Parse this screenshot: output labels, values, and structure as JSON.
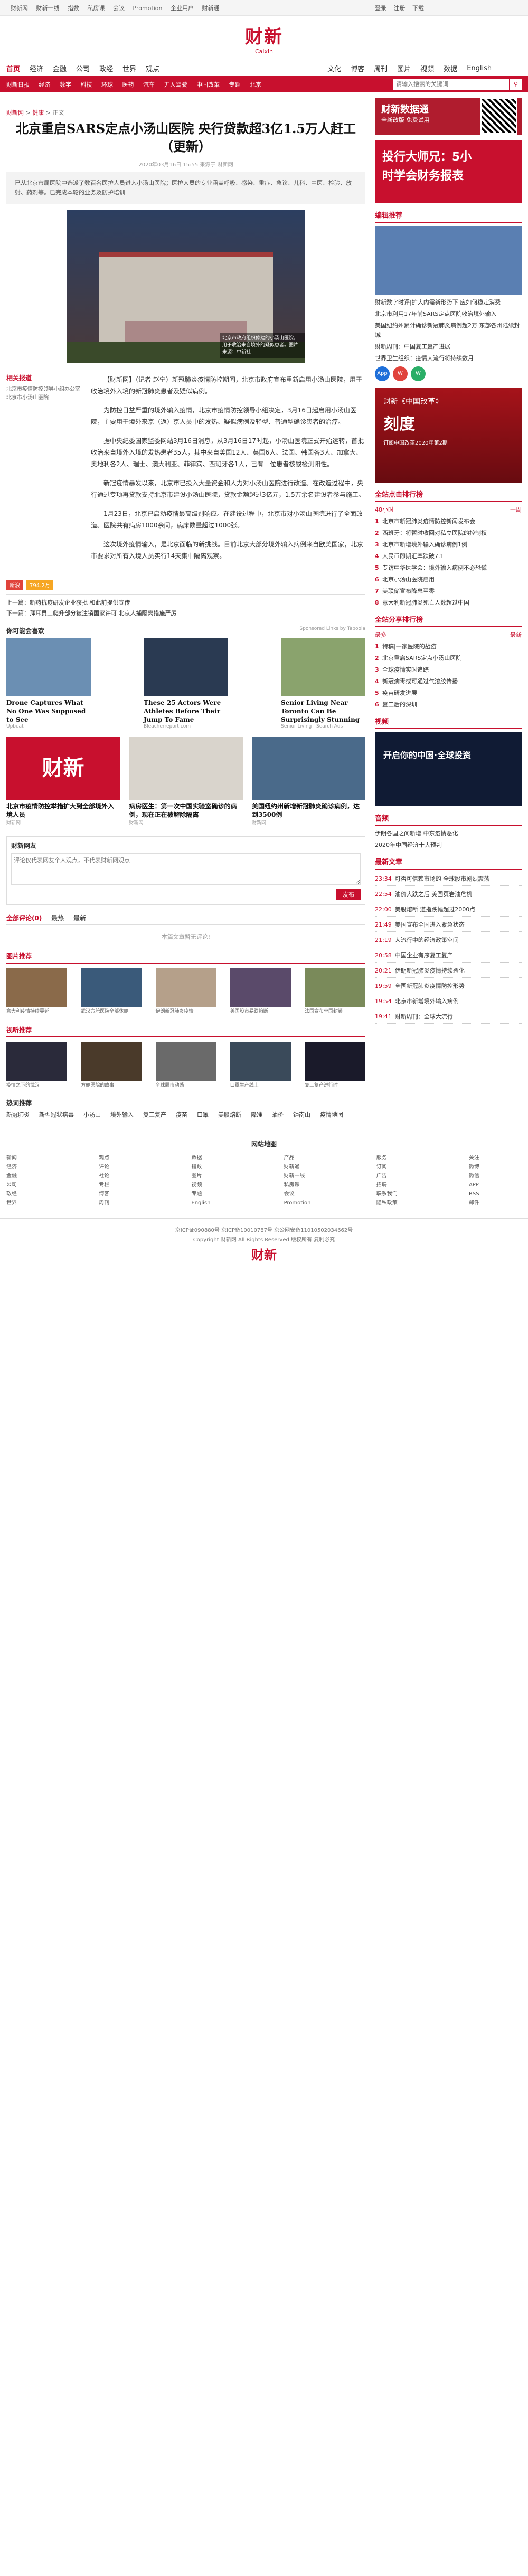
{
  "topbar": {
    "nav": [
      "财新网",
      "财新一线",
      "指数",
      "私房课",
      "会议",
      "Promotion",
      "企业用户",
      "财新通"
    ],
    "right": [
      "登录",
      "注册"
    ],
    "extra": "下载"
  },
  "logo": {
    "cn": "财新",
    "en": "Caixin"
  },
  "mainnav": {
    "items": [
      "首页",
      "经济",
      "金融",
      "公司",
      "政经",
      "世界",
      "观点",
      "文化",
      "博客",
      "周刊",
      "图片",
      "视频",
      "数据",
      "English"
    ]
  },
  "subnav": {
    "items": [
      "财新日报",
      "经济",
      "数字",
      "科技",
      "环球",
      "医药",
      "汽车",
      "无人驾驶",
      "中国改革",
      "专题",
      "北京"
    ],
    "search_placeholder": "请输入搜索的关键词"
  },
  "breadcrumb": {
    "a": "财新网",
    "b": "健康",
    "c": "正文"
  },
  "article": {
    "title": "北京重启SARS定点小汤山医院 央行贷款超3亿1.5万人赶工（更新）",
    "meta": "2020年03月16日 15:55  来源于 财新网",
    "summary": "已从北京市属医院中选派了数百名医护人员进入小汤山医院；医护人员的专业涵盖呼吸、感染、重症、急诊、儿科、中医、检验、放射、药剂等。已完成本轮的业务及防护培训",
    "photo_caption": "北京市政府组织修建的小汤山医院，用于收治来自境外的疑似患者。图片来源：中新社",
    "photo_side": "北京市疫情防控领导小组办公室 北京市小汤山医院",
    "p1": "【财新网】（记者 赵宁）新冠肺炎疫情防控期间，北京市政府宣布重新启用小汤山医院，用于收治境外入境的新冠肺炎患者及疑似病例。",
    "p2": "为防控日益严重的境外输入疫情，北京市疫情防控领导小组决定，3月16日起启用小汤山医院，主要用于境外来京（返）京人员中的发热、疑似病例及轻型、普通型确诊患者的治疗。",
    "p3": "据中央纪委国家监委网站3月16日消息，从3月16日17时起，小汤山医院正式开始运转，首批收治来自境外入境的发热患者35人，其中来自美国12人、英国6人、法国、韩国各3人、加拿大、奥地利各2人、瑞士、澳大利亚、菲律宾、西班牙各1人，已有一位患者核酸检测阳性。",
    "p4": "新冠疫情暴发以来，北京市已投入大量资金和人力对小汤山医院进行改造。在改造过程中，央行通过专项再贷款支持北京市建设小汤山医院，贷款金额超过3亿元，1.5万余名建设者参与施工。",
    "p5": "1月23日，北京已启动疫情最高级别响应。在建设过程中，北京市对小汤山医院进行了全面改造。医院共有病房1000余间，病床数量超过1000张。",
    "p6": "这次境外疫情输入，是北京面临的新挑战。目前北京大部分境外输入病例来自欧美国家，北京市要求对所有入境人员实行14天集中隔离观察。"
  },
  "share": {
    "weibo": "新浪",
    "count": "794.2万"
  },
  "prevnext": {
    "prev": "上一篇：新药抗疫研发企业获批 和此前提供宣传",
    "next": "下一篇：拜耳员工爬升部分被注销国家许可 北京人捕隔离措施严厉"
  },
  "maylike": {
    "title": "你可能会喜欢",
    "tab": "Sponsored Links by Taboola",
    "cards": [
      {
        "t": "Drone Captures What No One Was Supposed to See",
        "s": "Upbeat"
      },
      {
        "t": "These 25 Actors Were Athletes Before Their Jump To Fame",
        "s": "Bleacherreport.com"
      },
      {
        "t": "Senior Living Near Toronto Can Be Surprisingly Stunning",
        "s": "Senior Living | Search Ads"
      }
    ],
    "cards2": [
      {
        "t": "北京市疫情防控举措扩大到全部境外入境人员",
        "s": "财新网"
      },
      {
        "t": "病房医生：第一次中国实验室确诊的病例，现在正在被解除隔离",
        "s": "财新网"
      },
      {
        "t": "美国纽约州新增新冠肺炎确诊病例，达到3500例",
        "s": "财新网"
      }
    ]
  },
  "comment": {
    "title": "财新网友",
    "placeholder": "评论仅代表网友个人观点，不代表财新网观点",
    "button": "发布"
  },
  "tabs": {
    "a": "全部评论(0)",
    "b": "最热",
    "c": "最新"
  },
  "noreview": "本篇文章暂无评论!",
  "gallery": {
    "title": "图片推荐",
    "items": [
      "意大利疫情持续蔓延",
      "武汉方舱医院全部休舱",
      "伊朗新冠肺炎疫情",
      "美国股市暴跌熔断",
      "法国宣布全国封锁",
      "韩国疫情趋缓"
    ]
  },
  "gallery2": {
    "title": "视听推荐",
    "items": [
      "疫情之下的武汉",
      "方舱医院的故事",
      "全球股市动荡",
      "口罩生产线上",
      "复工复产进行时",
      "隔离中的生活"
    ]
  },
  "hotsearch": {
    "title": "热词推荐",
    "items": [
      "新冠肺炎",
      "新型冠状病毒",
      "小汤山",
      "境外输入",
      "复工复产",
      "疫苗",
      "口罩",
      "美股熔断",
      "降准",
      "油价",
      "钟南山",
      "疫情地图"
    ]
  },
  "sitemap": {
    "title": "网站地图",
    "cols": [
      [
        "新闻",
        "经济",
        "金融",
        "公司",
        "政经",
        "世界"
      ],
      [
        "观点",
        "评论",
        "社论",
        "专栏",
        "博客",
        "周刊"
      ],
      [
        "数据",
        "指数",
        "图片",
        "视频",
        "专题",
        "English"
      ],
      [
        "产品",
        "财新通",
        "财新一线",
        "私房课",
        "会议",
        "Promotion"
      ],
      [
        "服务",
        "订阅",
        "广告",
        "招聘",
        "联系我们",
        "隐私政策"
      ],
      [
        "关注",
        "微博",
        "微信",
        "APP",
        "RSS",
        "邮件"
      ]
    ]
  },
  "footer": {
    "l1": "京ICP证090880号 京ICP备10010787号 京公网安备11010502034662号",
    "l2": "Copyright 财新网 All Rights Reserved 版权所有 复制必究"
  },
  "right": {
    "ad1_title": "财新数据通",
    "ad1_sub": "全新改版 免费试用",
    "ad2_l1": "投行大师兄：5小",
    "ad2_l2": "时学会财务报表",
    "editor_title": "编辑推荐",
    "editor_items": [
      "财新数字时评|扩大内需新形势下 应如何稳定消费",
      "北京市利用17年前SARS定点医院收治境外输入",
      "美国纽约州累计确诊新冠肺炎病例超2万 东部各州陆续封城",
      "财新周刊：中国复工复产进展",
      "世界卫生组织：疫情大流行将持续数月"
    ],
    "apps": [
      "App",
      "W",
      "W"
    ],
    "reform_a": "财新《中国改革》",
    "reform_b": "刻度",
    "reform_c": "订阅中国改革2020年第2期",
    "hot_title": "全站点击排行榜",
    "hot_tabs": [
      "48小时",
      "一周"
    ],
    "hot_items": [
      "北京市新冠肺炎疫情防控新闻发布会",
      "西班牙：将暂时收回对私立医院的控制权",
      "北京市新增境外输入确诊病例1例",
      "人民币即期汇率跌破7.1",
      "专访中华医学会：境外输入病例不必恐慌",
      "北京小汤山医院启用",
      "美联储宣布降息至零",
      "意大利新冠肺炎死亡人数超过中国"
    ],
    "share_title": "全站分享排行榜",
    "share_tabs": [
      "最多",
      "最新"
    ],
    "share_items": [
      "特稿|一家医院的战疫",
      "北京重启SARS定点小汤山医院",
      "全球疫情实时追踪",
      "新冠病毒或可通过气溶胶传播",
      "疫苗研发进展",
      "复工后的深圳"
    ],
    "video_title": "视频",
    "video_text": "开启你的中国·全球投资",
    "audio_title": "音频",
    "audio_items": [
      "伊朗各国之间新增 中东疫情恶化",
      "2020年中国经济十大预判"
    ],
    "latest_title": "最新文章",
    "latest": [
      {
        "tm": "23:34",
        "t": "可否可信赖市场的 全球股市剧烈震荡"
      },
      {
        "tm": "22:54",
        "t": "油价大跌之后 美国页岩油危机"
      },
      {
        "tm": "22:00",
        "t": "美股熔断 道指跌幅超过2000点"
      },
      {
        "tm": "21:49",
        "t": "美国宣布全国进入紧急状态"
      },
      {
        "tm": "21:19",
        "t": "大流行中的经济政策空间"
      },
      {
        "tm": "20:58",
        "t": "中国企业有序复工复产"
      },
      {
        "tm": "20:21",
        "t": "伊朗新冠肺炎疫情持续恶化"
      },
      {
        "tm": "19:59",
        "t": "全国新冠肺炎疫情防控形势"
      },
      {
        "tm": "19:54",
        "t": "北京市新增境外输入病例"
      },
      {
        "tm": "19:41",
        "t": "财新周刊：全球大流行"
      }
    ]
  }
}
